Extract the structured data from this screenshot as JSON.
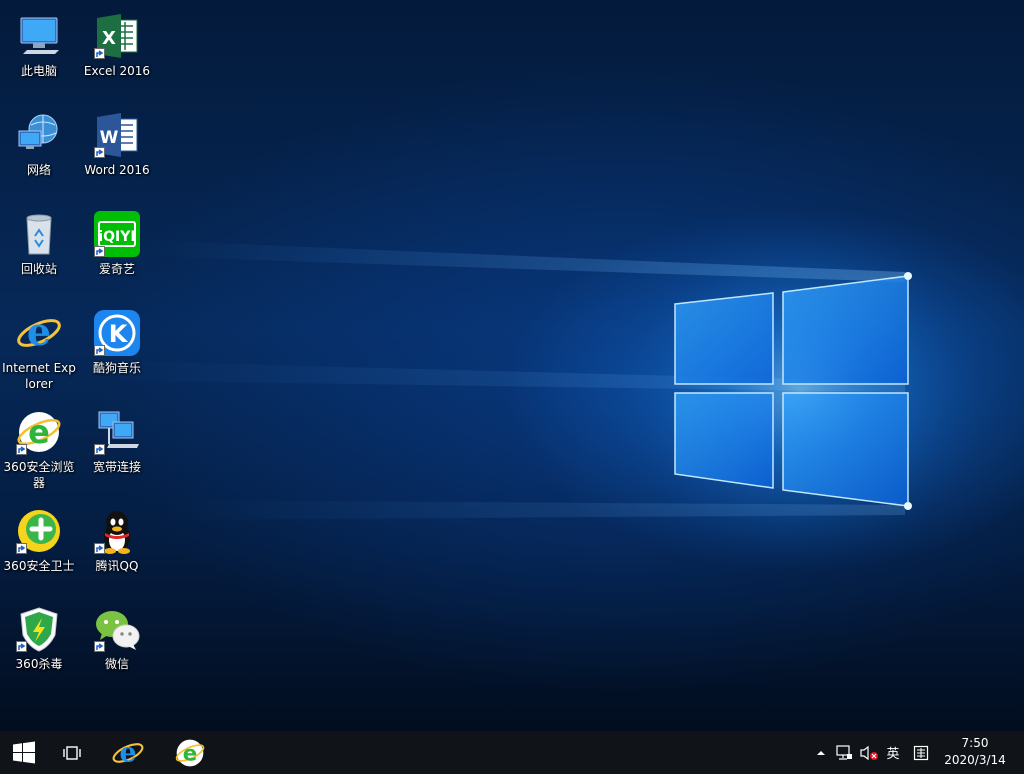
{
  "desktop": {
    "icons": [
      {
        "id": "this-pc",
        "label": "此电脑",
        "icon": "computer-icon",
        "shortcut": false
      },
      {
        "id": "network",
        "label": "网络",
        "icon": "network-icon",
        "shortcut": false
      },
      {
        "id": "recycle-bin",
        "label": "回收站",
        "icon": "recycle-bin-icon",
        "shortcut": false
      },
      {
        "id": "internet-explorer",
        "label": "Internet Explorer",
        "icon": "internet-explorer-icon",
        "shortcut": false
      },
      {
        "id": "360-browser",
        "label": "360安全浏览器",
        "icon": "360-browser-icon",
        "shortcut": true
      },
      {
        "id": "360-guard",
        "label": "360安全卫士",
        "icon": "360-guard-icon",
        "shortcut": true
      },
      {
        "id": "360-antivirus",
        "label": "360杀毒",
        "icon": "360-antivirus-icon",
        "shortcut": true
      },
      {
        "id": "excel-2016",
        "label": "Excel 2016",
        "icon": "excel-icon",
        "shortcut": true
      },
      {
        "id": "word-2016",
        "label": "Word 2016",
        "icon": "word-icon",
        "shortcut": true
      },
      {
        "id": "iqiyi",
        "label": "爱奇艺",
        "icon": "iqiyi-icon",
        "shortcut": true
      },
      {
        "id": "kugou",
        "label": "酷狗音乐",
        "icon": "kugou-icon",
        "shortcut": true
      },
      {
        "id": "broadband",
        "label": "宽带连接",
        "icon": "broadband-icon",
        "shortcut": true
      },
      {
        "id": "qq",
        "label": "腾讯QQ",
        "icon": "qq-icon",
        "shortcut": true
      },
      {
        "id": "wechat",
        "label": "微信",
        "icon": "wechat-icon",
        "shortcut": true
      }
    ]
  },
  "taskbar": {
    "start_icon": "windows-logo-icon",
    "task_view_icon": "task-view-icon",
    "pinned": [
      {
        "id": "ie",
        "icon": "internet-explorer-icon"
      },
      {
        "id": "360se",
        "icon": "360-browser-icon"
      }
    ],
    "tray": {
      "overflow_icon": "chevron-up-icon",
      "network_icon": "network-status-icon",
      "volume_icon": "volume-muted-icon",
      "ime_language": "英",
      "ime_mode_icon": "ime-pinyin-icon"
    },
    "clock": {
      "time": "7:50",
      "date": "2020/3/14"
    }
  },
  "colors": {
    "accent": "#1a8cff",
    "taskbar": "#101418",
    "excel_green": "#1d6f42",
    "word_blue": "#2b579a",
    "iqiyi_green": "#00be06",
    "kugou_blue": "#1c86ee"
  }
}
